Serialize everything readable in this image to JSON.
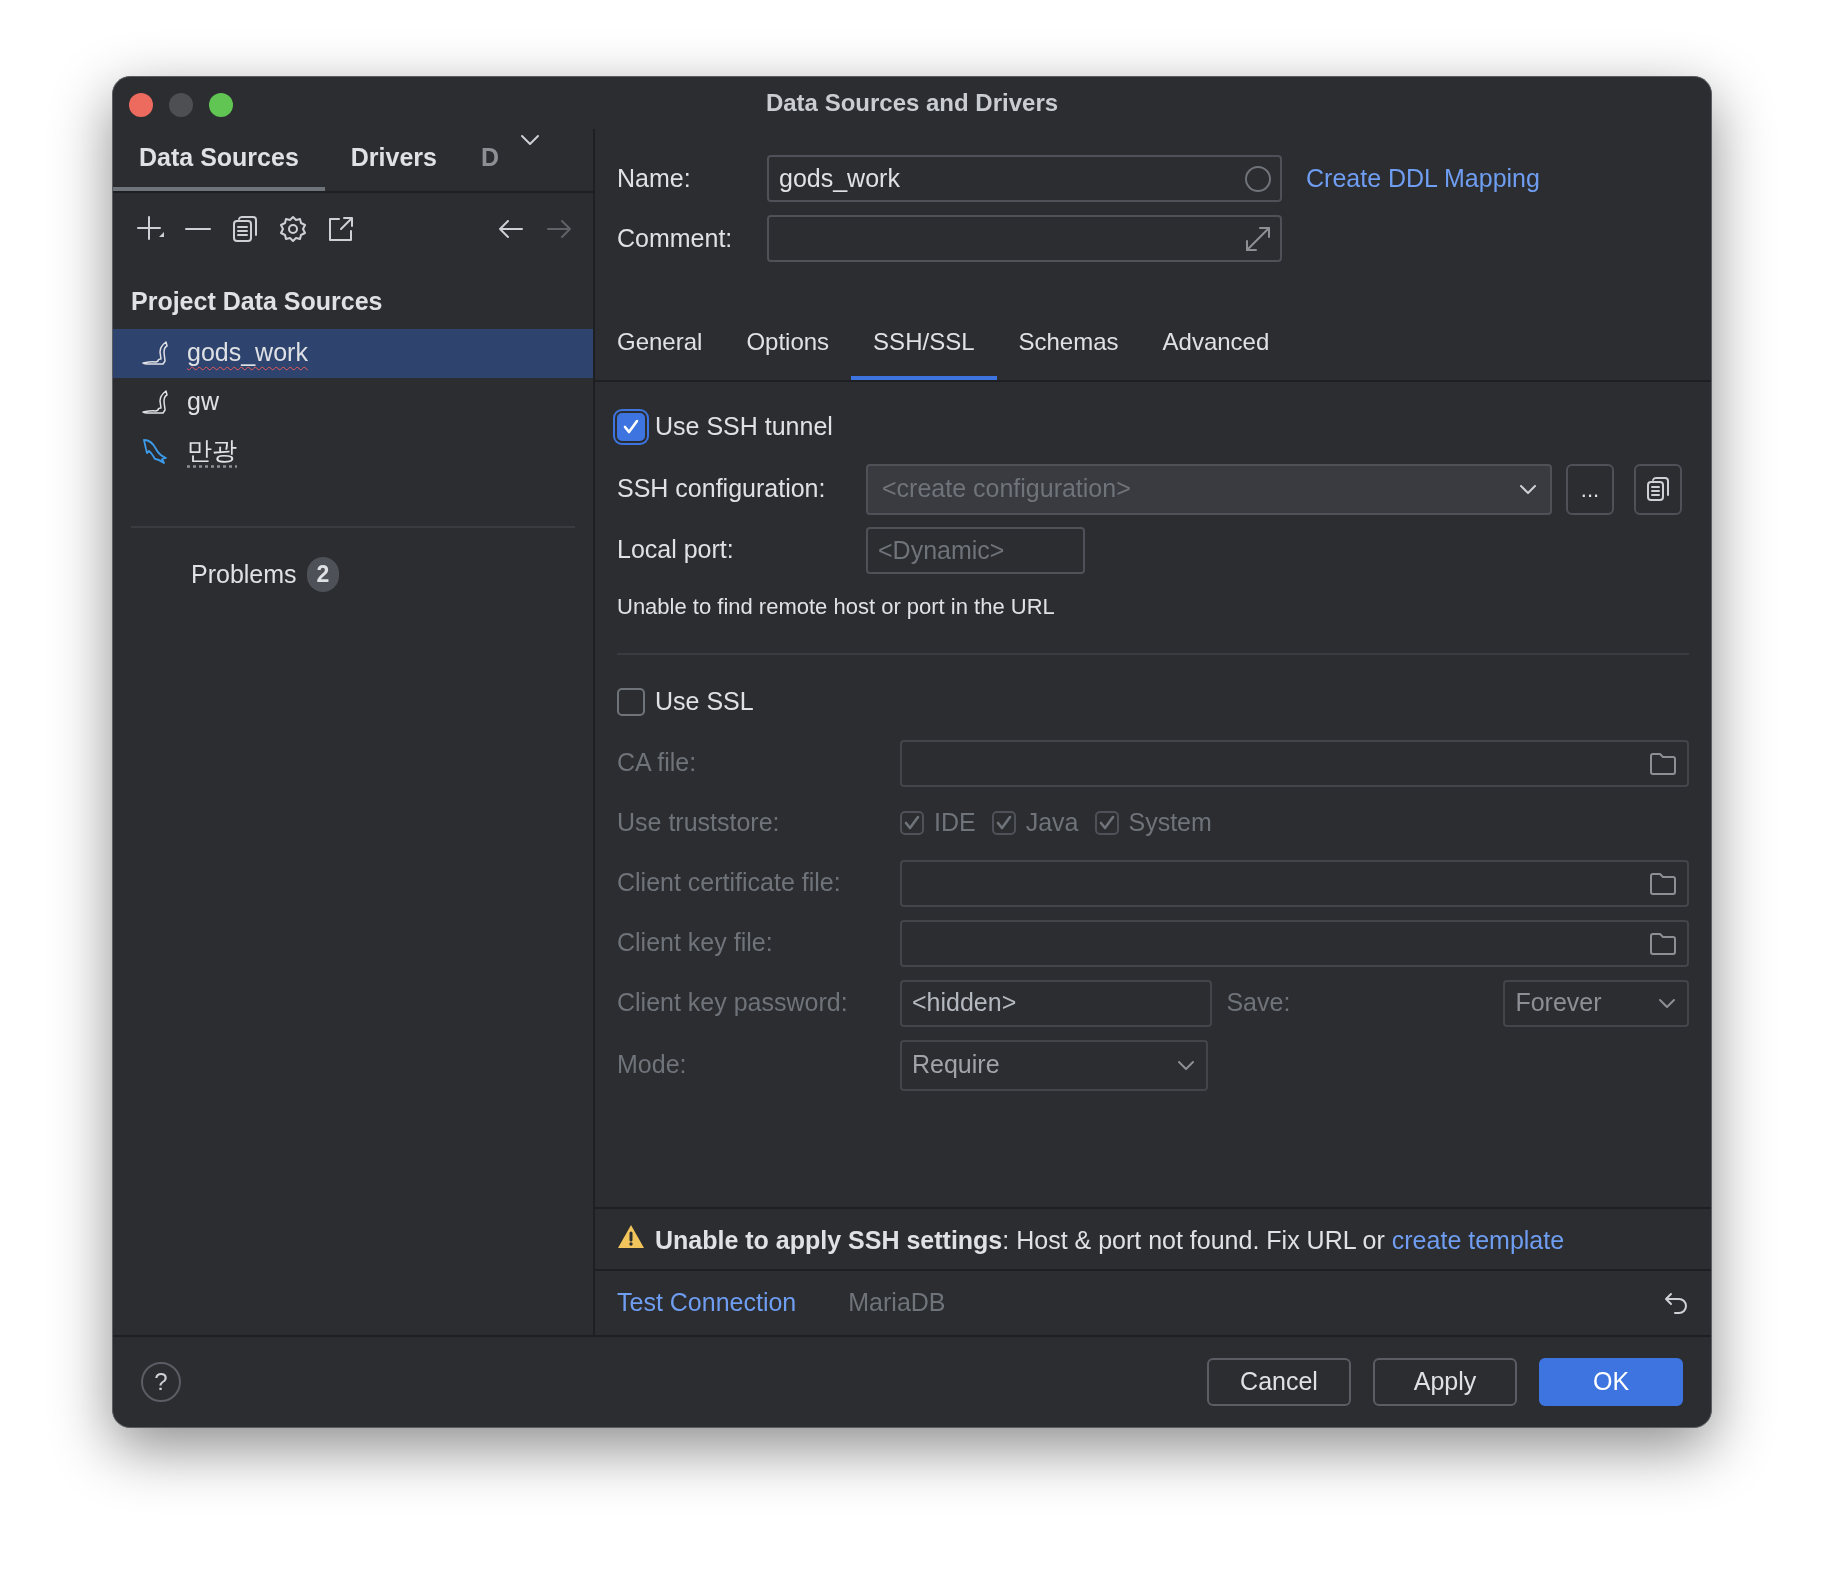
{
  "window": {
    "title": "Data Sources and Drivers"
  },
  "sidebar": {
    "tabs": [
      {
        "label": "Data Sources",
        "selected": true
      },
      {
        "label": "Drivers",
        "selected": false
      },
      {
        "label": "D",
        "selected": false
      }
    ],
    "section_title": "Project Data Sources",
    "items": [
      {
        "label": "gods_work",
        "kind": "mariadb",
        "selected": true,
        "misspelled": true
      },
      {
        "label": "gw",
        "kind": "mariadb",
        "selected": false
      },
      {
        "label": "만광",
        "kind": "mysql",
        "selected": false,
        "weak_warning": true
      }
    ],
    "problems": {
      "label": "Problems",
      "count": "2"
    }
  },
  "name_field": {
    "label": "Name:",
    "value": "gods_work"
  },
  "ddl_link": "Create DDL Mapping",
  "comment_field": {
    "label": "Comment:"
  },
  "tabs": [
    {
      "label": "General",
      "selected": false
    },
    {
      "label": "Options",
      "selected": false
    },
    {
      "label": "SSH/SSL",
      "selected": true
    },
    {
      "label": "Schemas",
      "selected": false
    },
    {
      "label": "Advanced",
      "selected": false
    }
  ],
  "ssh": {
    "use_tunnel": {
      "label": "Use SSH tunnel",
      "checked": true
    },
    "configuration": {
      "label": "SSH configuration:",
      "placeholder": "<create configuration>",
      "more_button": "..."
    },
    "local_port": {
      "label": "Local port:",
      "placeholder": "<Dynamic>"
    },
    "message": "Unable to find remote host or port in the URL"
  },
  "ssl": {
    "use_ssl": {
      "label": "Use SSL",
      "checked": false
    },
    "disabled": true,
    "ca_file": {
      "label": "CA file:"
    },
    "truststore": {
      "label": "Use truststore:",
      "options": [
        {
          "label": "IDE",
          "checked": true
        },
        {
          "label": "Java",
          "checked": true
        },
        {
          "label": "System",
          "checked": true
        }
      ]
    },
    "client_certificate_file": {
      "label": "Client certificate file:"
    },
    "client_key_file": {
      "label": "Client key file:"
    },
    "client_key_password": {
      "label": "Client key password:",
      "value": "<hidden>"
    },
    "save": {
      "label": "Save:",
      "value": "Forever"
    },
    "mode": {
      "label": "Mode:",
      "value": "Require"
    }
  },
  "warning": {
    "text": "**Unable to apply SSH settings**: Host & port not found. Fix URL or ",
    "link": "create template"
  },
  "footer": {
    "test_connection": "Test Connection",
    "driver": "MariaDB"
  },
  "help_button": "?",
  "buttons": [
    {
      "label": "Cancel",
      "kind": "default"
    },
    {
      "label": "Apply",
      "kind": "default"
    },
    {
      "label": "OK",
      "kind": "primary"
    }
  ]
}
